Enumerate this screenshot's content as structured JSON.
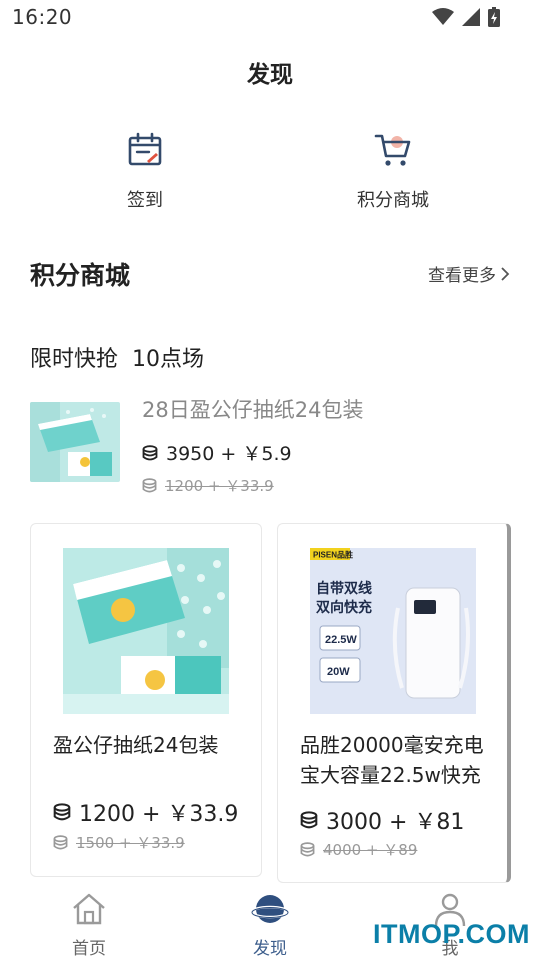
{
  "status_bar": {
    "time": "16:20"
  },
  "header": {
    "title": "发现"
  },
  "quick_entries": [
    {
      "label": "签到",
      "icon": "calendar-checkin-icon"
    },
    {
      "label": "积分商城",
      "icon": "shopping-cart-icon"
    }
  ],
  "section": {
    "title": "积分商城",
    "more_label": "查看更多"
  },
  "flash_sale": {
    "title": "限时快抢",
    "session": "10点场"
  },
  "featured": {
    "name": "28日盈公仔抽纸24包装",
    "price": "3950 + ￥5.9",
    "original_price": "1200 + ￥33.9"
  },
  "products": [
    {
      "name": "盈公仔抽纸24包装",
      "price": "1200 + ￥33.9",
      "original_price": "1500 + ￥33.9"
    },
    {
      "name": "品胜20000毫安充电宝大容量22.5w快充",
      "price": "3000 + ￥81",
      "original_price": "4000 + ￥89",
      "image_text": {
        "brand": "PISEN品胜",
        "headline_1": "自带双线",
        "headline_2": "双向快充",
        "spec_1": "22.5W",
        "spec_2": "20W"
      }
    }
  ],
  "tabbar": [
    {
      "label": "首页",
      "icon": "home-icon"
    },
    {
      "label": "发现",
      "icon": "discover-planet-icon",
      "active": true
    },
    {
      "label": "我",
      "icon": "user-icon"
    }
  ],
  "watermark": "ITMOP.COM",
  "colors": {
    "accent": "#3d5e8c",
    "checkin_accent": "#e0523f",
    "watermark": "#0b7fa8"
  }
}
